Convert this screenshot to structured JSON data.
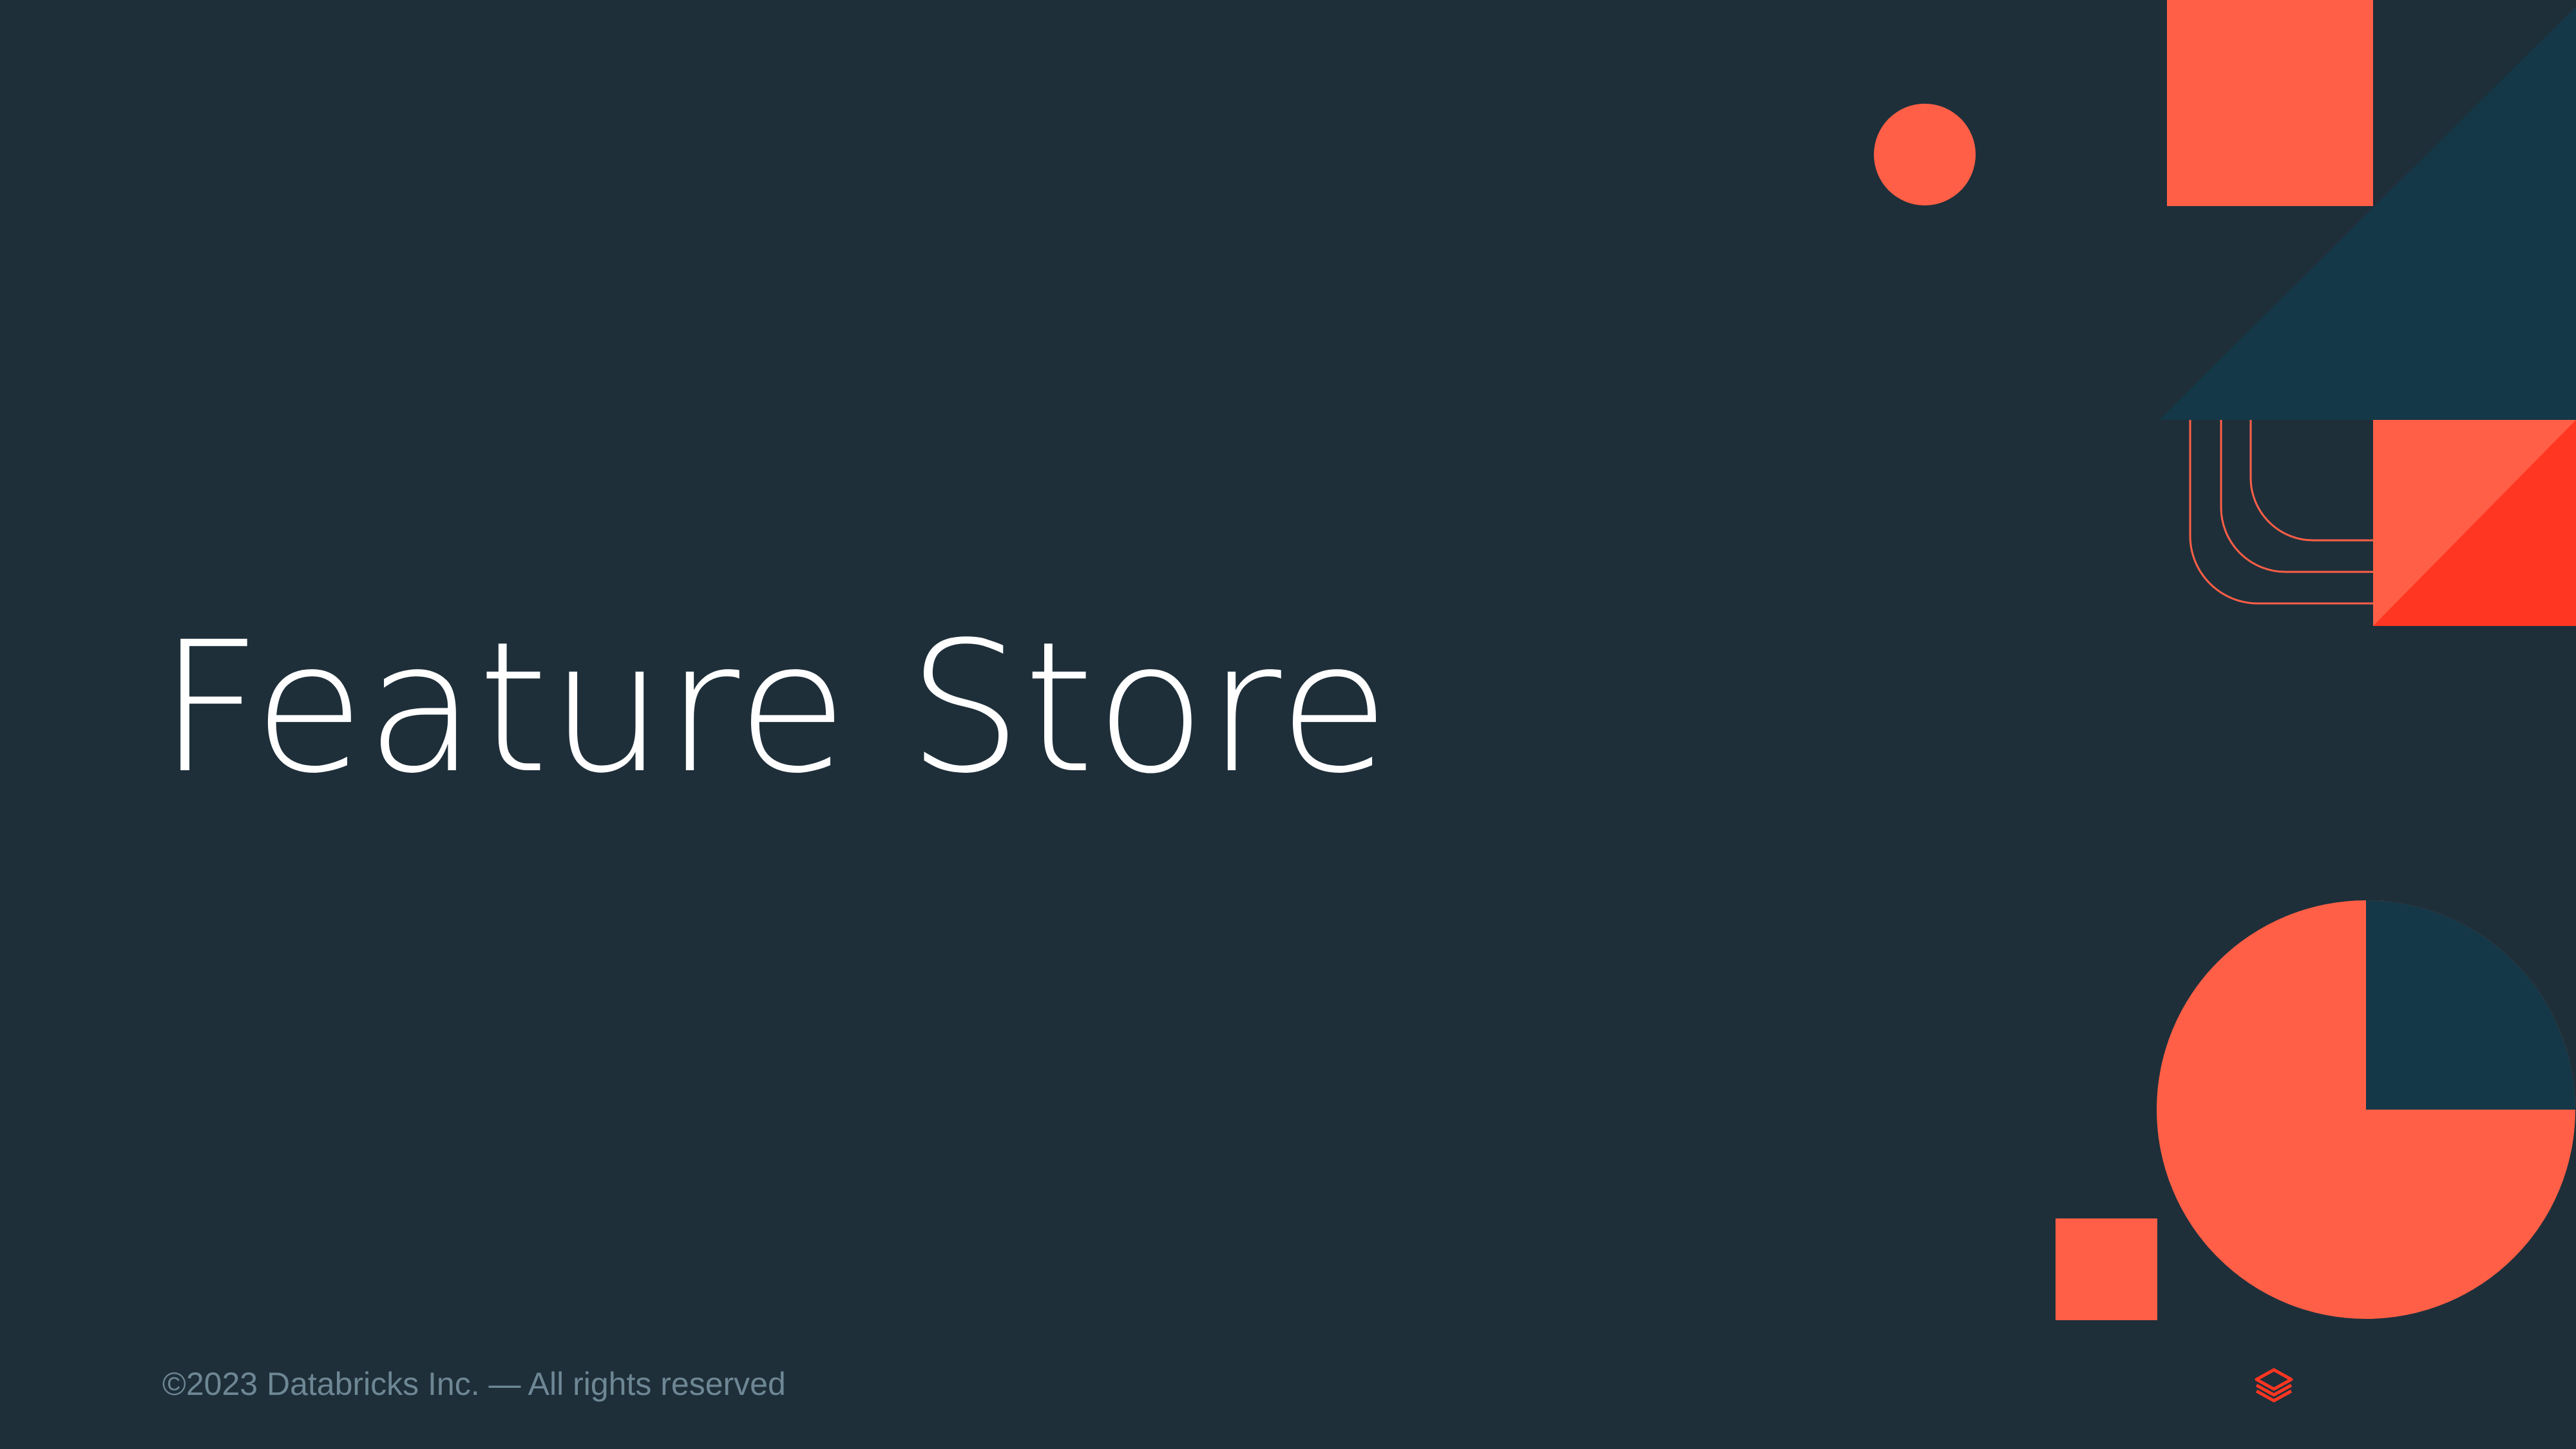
{
  "slide": {
    "title": "Feature Store",
    "footer": "©2023 Databricks Inc. — All rights reserved"
  },
  "logo": {
    "icon": "databricks-logo-icon"
  },
  "colors": {
    "background": "#1E2F3A",
    "accent": "#FF5F46",
    "accent_dark": "#FF3621",
    "teal": "#143847",
    "title": "#FFFFFF",
    "footer": "#6E8794"
  }
}
